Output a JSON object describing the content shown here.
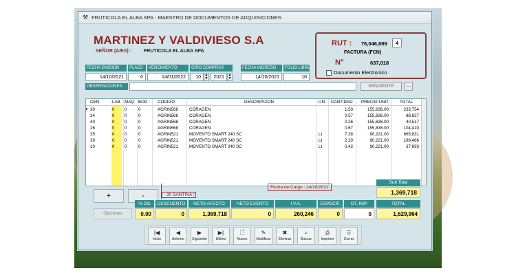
{
  "window": {
    "title": "FRUTICOLA EL ALBA SPA - MAESTRO DE DOCUMENTOS DE ADQUISICIONES"
  },
  "header": {
    "company_name": "MARTINEZ Y VALDIVIESO S.A",
    "senor_label": "SEÑOR (A/ES) :",
    "senor_value": "FRUTICOLA EL ALBA SPA"
  },
  "doc_box": {
    "rut_label": "RUT :",
    "rut_value": "76,046,889",
    "rut_dv": "4",
    "doc_type": "FACTURA (FCN)",
    "number_label": "N°",
    "number_value": "637,018",
    "electronic_label": "Documento Electronico"
  },
  "fields": {
    "fecha_emision_label": "FECHA EMISION",
    "fecha_emision": "14/10/2021",
    "plazo_label": "PLAZO",
    "plazo": "0",
    "vencimiento_label": "VENCIMIENTO",
    "vencimiento": "14/01/2022",
    "giro_label": "GIRO COMPRAS",
    "giro_month": "10",
    "giro_year": "2021",
    "fecha_ingreso_label": "FECHA INGRESO",
    "fecha_ingreso": "14/10/2021",
    "folio_label": "FOLIO LIBRO",
    "folio": "10",
    "observaciones_label": "OBSERVACIONES",
    "observaciones": "",
    "pendiente": "PENDIENTE",
    "ellipsis": "..."
  },
  "grid": {
    "columns": [
      "CEN",
      "LAB",
      "MAQ",
      "BOD",
      "CODIGO",
      "DESCRIPCION",
      "UN",
      "CANTIDAD",
      "PRECIO UNIT.",
      "TOTAL"
    ],
    "rows": [
      [
        "30",
        "0",
        "0",
        "0",
        "AGRIN568",
        "CORAGEN",
        "",
        "1.50",
        "155,836.00",
        "233,754"
      ],
      [
        "34",
        "0",
        "0",
        "0",
        "AGRIN568",
        "CORAGEN",
        "",
        "0.57",
        "155,836.00",
        "88,827"
      ],
      [
        "40",
        "0",
        "0",
        "0",
        "AGRIN568",
        "CORAGEN",
        "",
        "0.26",
        "155,836.00",
        "40,517"
      ],
      [
        "26",
        "0",
        "0",
        "0",
        "AGRIN568",
        "CORAGEN",
        "",
        "0.67",
        "155,836.00",
        "104,410"
      ],
      [
        "35",
        "0",
        "0",
        "0",
        "AGRIN521",
        "MOVENTO SMART 240 SC",
        "Lt",
        "7.38",
        "90,221.00",
        "665,831"
      ],
      [
        "39",
        "0",
        "0",
        "0",
        "AGRIN521",
        "MOVENTO SMART 240 SC",
        "Lt",
        "2.20",
        "90,221.00",
        "198,486"
      ],
      [
        "10",
        "0",
        "0",
        "0",
        "AGRIN521",
        "MOVENTO SMART 240 SC",
        "Lt",
        "0.42",
        "90,221.00",
        "37,893"
      ]
    ]
  },
  "below_grid": {
    "plus": "+",
    "minus": "-",
    "santina": "- 30 SANTINA /",
    "fecha_cargo": "Fecha de Cargo : 14/10/2021",
    "subtotal_label": "Sub Total",
    "subtotal_value": "1,369,718"
  },
  "totals": {
    "headers": [
      "% DG",
      "DESCUENTO",
      "NETO AFECTO",
      "NETO EXENTO",
      "I.V.A.",
      "ESPECIF.",
      "OT. IMP.",
      "TOTAL"
    ],
    "values": [
      "0.00",
      "0",
      "1,369,718",
      "0",
      "260,246",
      "0",
      "0",
      "1,629,964"
    ],
    "opciones": "Opciones"
  },
  "toolbar": {
    "buttons": [
      {
        "label": "Inicio",
        "icon": "first-record-icon",
        "glyph": "|◀"
      },
      {
        "label": "Anterior",
        "icon": "previous-record-icon",
        "glyph": "◀"
      },
      {
        "label": "Siguiente",
        "icon": "next-record-icon",
        "glyph": "▶"
      },
      {
        "label": "Ultimo",
        "icon": "last-record-icon",
        "glyph": "▶|"
      },
      {
        "label": "Nuevo",
        "icon": "new-document-icon",
        "glyph": "🗋"
      },
      {
        "label": "Modificar",
        "icon": "edit-icon",
        "glyph": "✎"
      },
      {
        "label": "Eliminar",
        "icon": "delete-icon",
        "glyph": "✖"
      },
      {
        "label": "Buscar",
        "icon": "binoculars-icon",
        "glyph": "⌕"
      },
      {
        "label": "Imprimir",
        "icon": "printer-icon",
        "glyph": "⎙"
      },
      {
        "label": "Cerrar",
        "icon": "door-exit-icon",
        "glyph": "⍈"
      }
    ]
  },
  "colors": {
    "accent_teal": "#2f8f8f",
    "brand_red": "#9a1f1f",
    "total_yellow": "#fff59a",
    "lab_column_yellow": "#fff36a"
  }
}
